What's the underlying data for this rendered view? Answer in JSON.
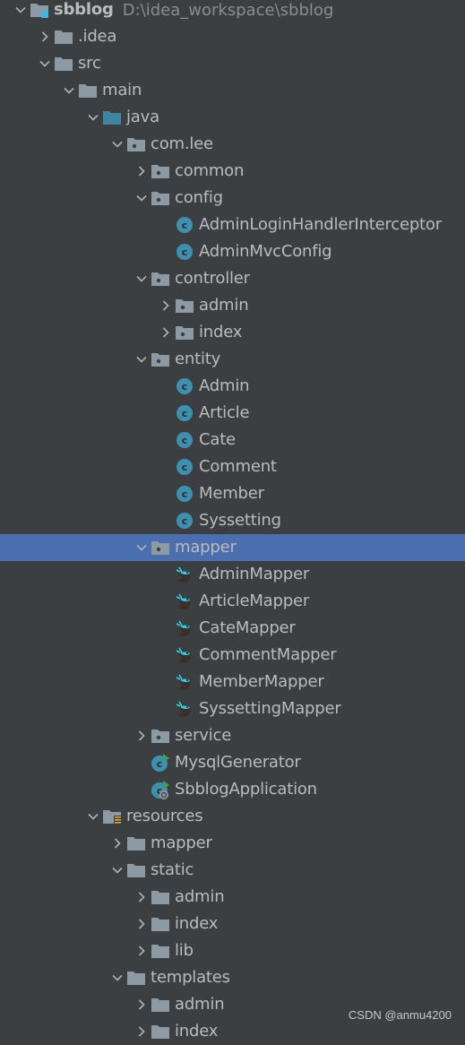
{
  "colors": {
    "background": "#3c3f41",
    "selected_row": "#4b6eaf",
    "text": "#bbbbbb",
    "path_text": "#8a8d90",
    "folder": "#8e9aa3",
    "source_folder": "#3e86a0",
    "class_icon": "#3f8fae",
    "mapper_icon_accent": "#35d0e8",
    "resources_badge": "#e0a538",
    "run_badge": "#499c54"
  },
  "tree": [
    {
      "depth": 0,
      "arrow": "expanded",
      "icon": "module-folder-icon",
      "label": "sbblog",
      "bold": true,
      "path": "D:\\idea_workspace\\sbblog"
    },
    {
      "depth": 1,
      "arrow": "collapsed",
      "icon": "folder-icon",
      "label": ".idea"
    },
    {
      "depth": 1,
      "arrow": "expanded",
      "icon": "folder-icon",
      "label": "src"
    },
    {
      "depth": 2,
      "arrow": "expanded",
      "icon": "folder-icon",
      "label": "main"
    },
    {
      "depth": 3,
      "arrow": "expanded",
      "icon": "source-folder-icon",
      "label": "java"
    },
    {
      "depth": 4,
      "arrow": "expanded",
      "icon": "package-icon",
      "label": "com.lee"
    },
    {
      "depth": 5,
      "arrow": "collapsed",
      "icon": "package-icon",
      "label": "common"
    },
    {
      "depth": 5,
      "arrow": "expanded",
      "icon": "package-icon",
      "label": "config"
    },
    {
      "depth": 6,
      "arrow": "none",
      "icon": "class-icon",
      "label": "AdminLoginHandlerInterceptor"
    },
    {
      "depth": 6,
      "arrow": "none",
      "icon": "class-icon",
      "label": "AdminMvcConfig"
    },
    {
      "depth": 5,
      "arrow": "expanded",
      "icon": "package-icon",
      "label": "controller"
    },
    {
      "depth": 6,
      "arrow": "collapsed",
      "icon": "package-icon",
      "label": "admin"
    },
    {
      "depth": 6,
      "arrow": "collapsed",
      "icon": "package-icon",
      "label": "index"
    },
    {
      "depth": 5,
      "arrow": "expanded",
      "icon": "package-icon",
      "label": "entity"
    },
    {
      "depth": 6,
      "arrow": "none",
      "icon": "class-icon",
      "label": "Admin"
    },
    {
      "depth": 6,
      "arrow": "none",
      "icon": "class-icon",
      "label": "Article"
    },
    {
      "depth": 6,
      "arrow": "none",
      "icon": "class-icon",
      "label": "Cate"
    },
    {
      "depth": 6,
      "arrow": "none",
      "icon": "class-icon",
      "label": "Comment"
    },
    {
      "depth": 6,
      "arrow": "none",
      "icon": "class-icon",
      "label": "Member"
    },
    {
      "depth": 6,
      "arrow": "none",
      "icon": "class-icon",
      "label": "Syssetting"
    },
    {
      "depth": 5,
      "arrow": "expanded",
      "icon": "package-icon",
      "label": "mapper",
      "selected": true
    },
    {
      "depth": 6,
      "arrow": "none",
      "icon": "mybatis-mapper-icon",
      "label": "AdminMapper"
    },
    {
      "depth": 6,
      "arrow": "none",
      "icon": "mybatis-mapper-icon",
      "label": "ArticleMapper"
    },
    {
      "depth": 6,
      "arrow": "none",
      "icon": "mybatis-mapper-icon",
      "label": "CateMapper"
    },
    {
      "depth": 6,
      "arrow": "none",
      "icon": "mybatis-mapper-icon",
      "label": "CommentMapper"
    },
    {
      "depth": 6,
      "arrow": "none",
      "icon": "mybatis-mapper-icon",
      "label": "MemberMapper"
    },
    {
      "depth": 6,
      "arrow": "none",
      "icon": "mybatis-mapper-icon",
      "label": "SyssettingMapper"
    },
    {
      "depth": 5,
      "arrow": "collapsed",
      "icon": "package-icon",
      "label": "service"
    },
    {
      "depth": 5,
      "arrow": "none",
      "icon": "runnable-class-icon",
      "label": "MysqlGenerator"
    },
    {
      "depth": 5,
      "arrow": "none",
      "icon": "spring-boot-app-icon",
      "label": "SbblogApplication"
    },
    {
      "depth": 3,
      "arrow": "expanded",
      "icon": "resources-folder-icon",
      "label": "resources"
    },
    {
      "depth": 4,
      "arrow": "collapsed",
      "icon": "folder-icon",
      "label": "mapper"
    },
    {
      "depth": 4,
      "arrow": "expanded",
      "icon": "folder-icon",
      "label": "static"
    },
    {
      "depth": 5,
      "arrow": "collapsed",
      "icon": "folder-icon",
      "label": "admin"
    },
    {
      "depth": 5,
      "arrow": "collapsed",
      "icon": "folder-icon",
      "label": "index"
    },
    {
      "depth": 5,
      "arrow": "collapsed",
      "icon": "folder-icon",
      "label": "lib"
    },
    {
      "depth": 4,
      "arrow": "expanded",
      "icon": "folder-icon",
      "label": "templates"
    },
    {
      "depth": 5,
      "arrow": "collapsed",
      "icon": "folder-icon",
      "label": "admin"
    },
    {
      "depth": 5,
      "arrow": "collapsed",
      "icon": "folder-icon",
      "label": "index"
    }
  ],
  "watermark": "CSDN @anmu4200"
}
